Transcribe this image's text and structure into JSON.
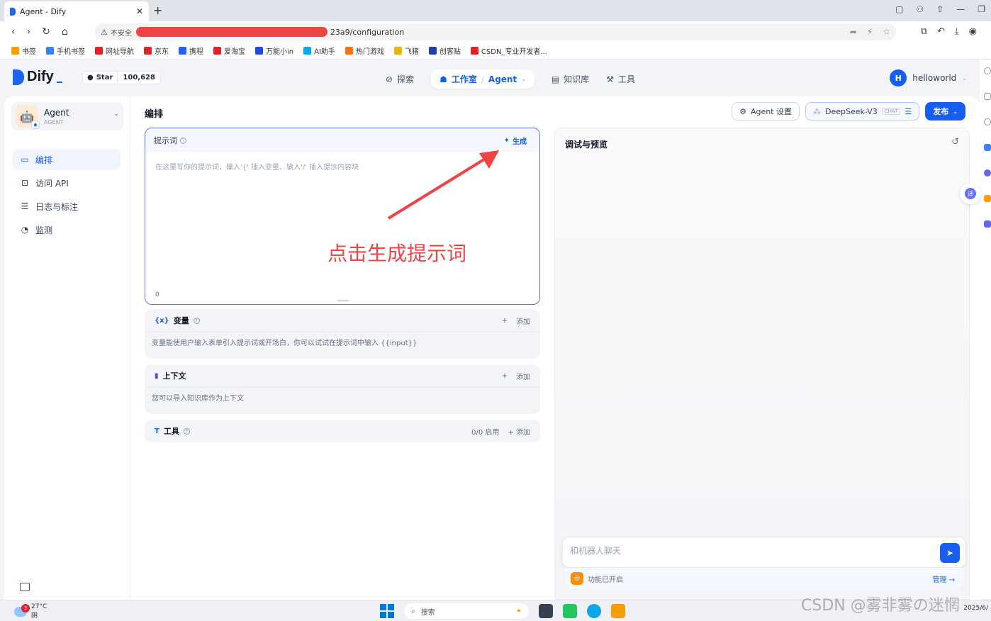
{
  "browser": {
    "tab_title": "Agent - Dify",
    "url_warning": "不安全",
    "url_suffix": "23a9/configuration",
    "bookmarks": [
      {
        "label": "书签",
        "color": "#f59e0b"
      },
      {
        "label": "手机书签",
        "color": "#3b82f6"
      },
      {
        "label": "网址导航",
        "color": "#dc2626"
      },
      {
        "label": "京东",
        "color": "#dc2626"
      },
      {
        "label": "携程",
        "color": "#2563eb"
      },
      {
        "label": "爱淘宝",
        "color": "#dc2626"
      },
      {
        "label": "万能小in",
        "color": "#1d4ed8"
      },
      {
        "label": "AI助手",
        "color": "#0ea5e9"
      },
      {
        "label": "热门游戏",
        "color": "#f97316"
      },
      {
        "label": "飞猪",
        "color": "#eab308"
      },
      {
        "label": "创客贴",
        "color": "#1e40af"
      },
      {
        "label": "CSDN_专业开发者...",
        "color": "#dc2626"
      }
    ]
  },
  "header": {
    "logo": "Dify",
    "github_star": "Star",
    "github_count": "100,628",
    "nav": {
      "explore": "探索",
      "studio": "工作室",
      "separator": "/",
      "agent": "Agent",
      "knowledge": "知识库",
      "tools": "工具"
    },
    "user_initial": "H",
    "user_name": "helloworld"
  },
  "sidebar": {
    "app_name": "Agent",
    "app_type": "AGENT",
    "items": [
      {
        "label": "编排",
        "icon": "layout-icon",
        "active": true
      },
      {
        "label": "访问 API",
        "icon": "terminal-icon",
        "active": false
      },
      {
        "label": "日志与标注",
        "icon": "logs-icon",
        "active": false
      },
      {
        "label": "监测",
        "icon": "monitor-icon",
        "active": false
      }
    ]
  },
  "editor": {
    "title": "编排",
    "agent_settings": "Agent 设置",
    "model_name": "DeepSeek-V3",
    "model_badge": "CHAT",
    "publish": "发布",
    "prompt_label": "提示词",
    "generate": "生成",
    "prompt_placeholder": "在这里写你的提示词，输入'{' 插入变量、输入'/' 插入提示内容块",
    "prompt_count": "0",
    "annotation": "点击生成提示词",
    "variables": {
      "title": "变量",
      "add": "添加",
      "desc": "变量能使用户输入表单引入提示词或开场白，你可以试试在提示词中输入 {{input}}"
    },
    "context": {
      "title": "上下文",
      "add": "添加",
      "desc": "您可以导入知识库作为上下文"
    },
    "tools": {
      "title": "工具",
      "enabled": "0/0 启用",
      "add": "添加"
    }
  },
  "preview": {
    "title": "调试与预览",
    "chat_placeholder": "和机器人聊天",
    "features_enabled": "功能已开启",
    "manage": "管理 →"
  },
  "taskbar": {
    "temperature": "27°C",
    "weather": "阴",
    "notification_count": "3",
    "search": "搜索",
    "date": "2025/6/",
    "watermark": "CSDN @雾非雾の迷惘"
  },
  "colors": {
    "primary": "#155eef",
    "annotation": "#ef4444",
    "prompt_border": "#6172f3"
  }
}
